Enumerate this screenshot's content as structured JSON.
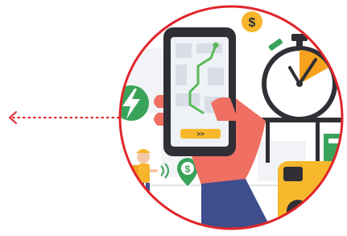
{
  "illustration": {
    "pointer_arrow_icon": "dotted-left-arrow",
    "phone": {
      "button_label": ">>",
      "button_icon": "double-chevron-right"
    },
    "coin_top": {
      "label": "$"
    },
    "coin_pin": {
      "label": "$"
    },
    "colors": {
      "ring_red": "#e0262b",
      "phone_dark": "#2f2f35",
      "map_bg": "#eef2f7",
      "route_green": "#5bb85b",
      "hand_pink": "#ef6f62",
      "sleeve_navy": "#3e4d8c",
      "coin_yellow": "#f6b52d",
      "bolt_green": "#3aa35a",
      "timer_orange": "#f7a21e",
      "van_yellow": "#f7b82b"
    }
  }
}
